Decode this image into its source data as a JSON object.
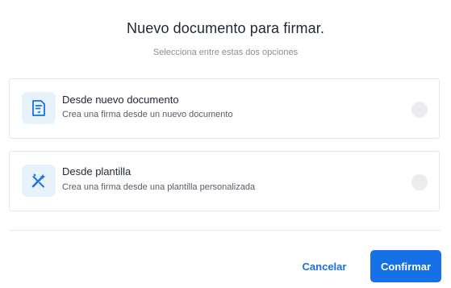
{
  "dialog": {
    "title": "Nuevo documento para firmar.",
    "subtitle": "Selecciona entre estas dos opciones"
  },
  "options": [
    {
      "title": "Desde nuevo documento",
      "description": "Crea una firma desde un nuevo documento",
      "icon": "document-pen-icon",
      "selected": false
    },
    {
      "title": "Desde plantilla",
      "description": "Crea una firma desde una plantilla personalizada",
      "icon": "magic-wand-icon",
      "selected": false
    }
  ],
  "actions": {
    "cancel_label": "Cancelar",
    "confirm_label": "Confirmar"
  },
  "colors": {
    "accent": "#1670e6",
    "icon_bg": "#e8f2fd",
    "radio_bg": "#ececee",
    "border": "#e3e6ea"
  }
}
